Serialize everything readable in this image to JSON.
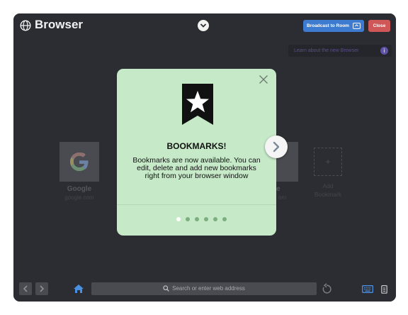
{
  "titlebar": {
    "title": "Browser",
    "broadcast_label": "Broadcast to Room",
    "close_label": "Close"
  },
  "banner": {
    "learn_text": "Learn about the new Browser",
    "info_glyph": "i"
  },
  "bookmarks": [
    {
      "name": "Google",
      "url": "google.com"
    },
    {
      "name": "e",
      "url": "om"
    }
  ],
  "add_tile": {
    "plus": "+",
    "label_line1": "Add",
    "label_line2": "Bookmark"
  },
  "modal": {
    "title": "BOOKMARKS!",
    "body": "Bookmarks are now available. You can edit, delete and add new bookmarks right from your browser window",
    "page_count": 6,
    "active_page": 1
  },
  "toolbar": {
    "search_placeholder": "Search or enter web address"
  },
  "colors": {
    "window_bg": "#2c2d33",
    "modal_bg": "#c6e9c8",
    "broadcast_blue": "#3d7bd0",
    "close_red": "#cf5757",
    "home_blue": "#4a90e2"
  },
  "icons": [
    "globe-icon",
    "chevron-down-icon",
    "cast-icon",
    "info-icon",
    "google-logo-icon",
    "close-icon",
    "bookmark-star-icon",
    "chevron-right-icon",
    "arrow-left-icon",
    "arrow-right-icon",
    "home-icon",
    "search-icon",
    "reload-icon",
    "keyboard-icon",
    "clipboard-icon"
  ]
}
